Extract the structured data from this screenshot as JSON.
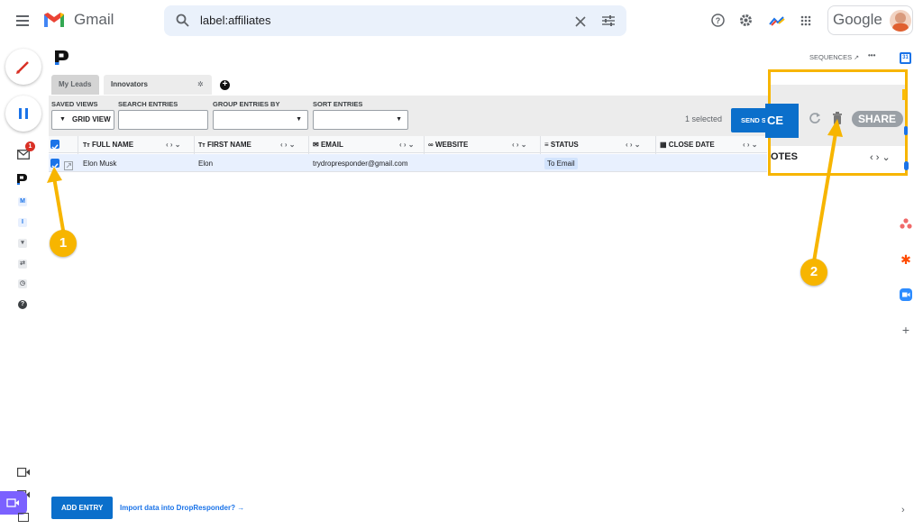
{
  "topbar": {
    "app_name": "Gmail",
    "search_query": "label:affiliates",
    "google_label": "Google"
  },
  "rail": {
    "inbox_badge": "1",
    "m_label": "M",
    "i_label": "I"
  },
  "panel": {
    "sequences_link": "SEQUENCES",
    "more_label": "•••",
    "tabs": [
      {
        "label": "My Leads"
      },
      {
        "label": "Innovators"
      }
    ]
  },
  "toolbar": {
    "saved_views_label": "SAVED VIEWS",
    "grid_view_label": "GRID VIEW",
    "search_entries_label": "SEARCH ENTRIES",
    "group_entries_label": "GROUP ENTRIES BY",
    "sort_entries_label": "SORT ENTRIES",
    "selected_text": "1 selected",
    "send_label": "SEND S",
    "send_overlay": "CE",
    "share_label": "SHARE"
  },
  "table": {
    "columns": [
      {
        "label": "FULL NAME",
        "icon": "text-type-icon"
      },
      {
        "label": "FIRST NAME",
        "icon": "text-type-icon"
      },
      {
        "label": "EMAIL",
        "icon": "mail-icon"
      },
      {
        "label": "WEBSITE",
        "icon": "link-icon"
      },
      {
        "label": "STATUS",
        "icon": "list-icon"
      },
      {
        "label": "CLOSE DATE",
        "icon": "calendar-icon"
      },
      {
        "label": "OTES",
        "icon": ""
      }
    ],
    "rows": [
      {
        "full_name": "Elon Musk",
        "first_name": "Elon",
        "email": "trydropresponder@gmail.com",
        "website": "",
        "status": "To Email",
        "close_date": ""
      }
    ]
  },
  "footer": {
    "add_entry_label": "ADD ENTRY",
    "import_label": "Import data into DropResponder? →"
  },
  "callouts": {
    "one": "1",
    "two": "2"
  },
  "colors": {
    "accent_blue": "#1a73e8",
    "send_blue": "#0b6fcb",
    "callout_yellow": "#f7b500",
    "meet_purple": "#7b61ff"
  }
}
